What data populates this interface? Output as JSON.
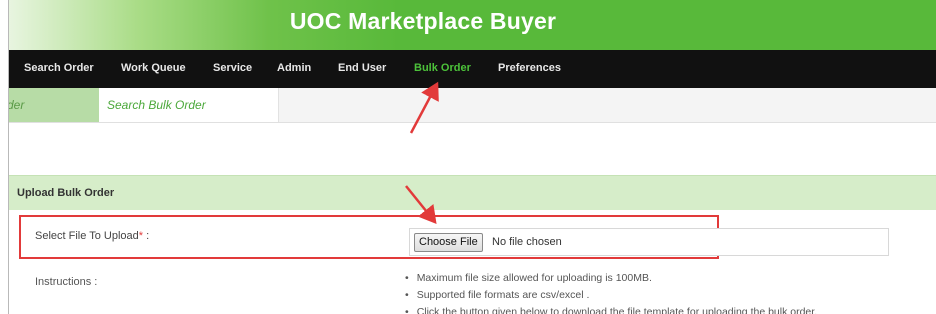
{
  "app": {
    "title": "UOC Marketplace Buyer"
  },
  "nav": {
    "items": [
      {
        "label": "Search Order"
      },
      {
        "label": "Work Queue"
      },
      {
        "label": "Service"
      },
      {
        "label": "Admin"
      },
      {
        "label": "End User"
      },
      {
        "label": "Bulk Order",
        "active": true
      },
      {
        "label": "Preferences"
      }
    ]
  },
  "subtabs": {
    "items": [
      {
        "label": "rder"
      },
      {
        "label": "Search Bulk Order"
      }
    ]
  },
  "section": {
    "title": "Upload Bulk Order"
  },
  "upload": {
    "label": "Select File To Upload",
    "required_mark": "*",
    "label_suffix": " :",
    "button_label": "Choose File",
    "status": "No file chosen"
  },
  "instructions": {
    "label": "Instructions :",
    "items": [
      "Maximum file size allowed for uploading is 100MB.",
      "Supported file formats are csv/excel .",
      "Click the button given below to download the file template for uploading the bulk order."
    ]
  },
  "colors": {
    "brand_green": "#58b93a",
    "nav_bg": "#111111",
    "nav_active": "#4cc23a",
    "section_bg": "#d6edc9",
    "annotation_red": "#e23a3a"
  }
}
